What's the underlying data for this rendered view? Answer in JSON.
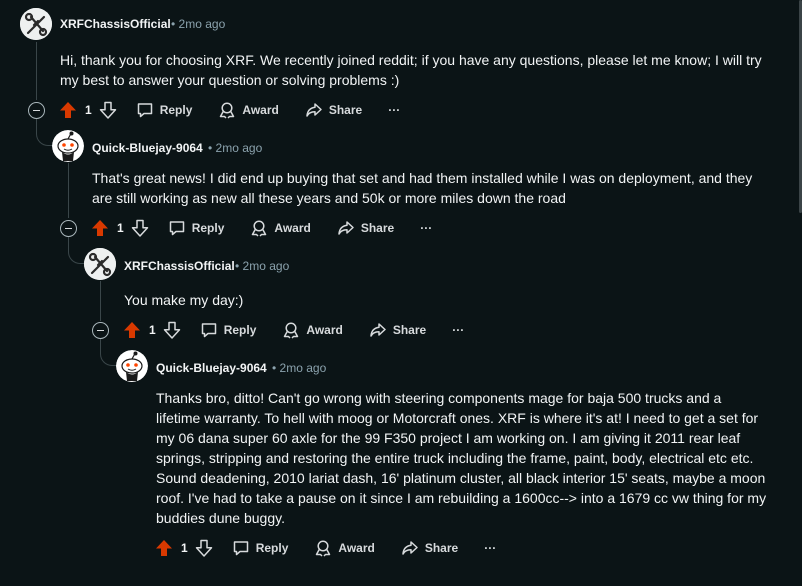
{
  "comments": [
    {
      "author": "XRFChassisOfficial",
      "time": "2mo ago",
      "body": "Hi, thank you for choosing XRF. We recently joined reddit; if you have any questions, please let me know; I will try my best to answer your question or solving problems :)",
      "votes": "1",
      "reply_label": "Reply",
      "award_label": "Award",
      "share_label": "Share",
      "more_label": "···"
    },
    {
      "author": "Quick-Bluejay-9064",
      "time": "2mo ago",
      "body": "That's great news! I did end up buying that set and had them installed while I was on deployment, and they are still working as new all these years and 50k or more miles down the road",
      "votes": "1",
      "reply_label": "Reply",
      "award_label": "Award",
      "share_label": "Share",
      "more_label": "···"
    },
    {
      "author": "XRFChassisOfficial",
      "time": "2mo ago",
      "body": "You make my day:)",
      "votes": "1",
      "reply_label": "Reply",
      "award_label": "Award",
      "share_label": "Share",
      "more_label": "···"
    },
    {
      "author": "Quick-Bluejay-9064",
      "time": "2mo ago",
      "body": "Thanks bro, ditto! Can't go wrong with steering components mage for baja 500 trucks and a lifetime warranty. To hell with moog or Motorcraft ones. XRF is where it's at! I need to get a set for my 06 dana super 60 axle for the 99 F350 project I am working on. I am giving it 2011 rear leaf springs, stripping and restoring the entire truck including the frame, paint, body, electrical etc etc. Sound deadening, 2010 lariat dash, 16' platinum cluster, all black interior 15' seats, maybe a moon roof. I've had to take a pause on it since I am rebuilding a 1600cc--> into a 1679 cc vw thing for my buddies dune buggy.",
      "votes": "1",
      "reply_label": "Reply",
      "award_label": "Award",
      "share_label": "Share",
      "more_label": "···"
    }
  ],
  "icons": {
    "upvote": "upvote-icon",
    "downvote": "downvote-icon",
    "reply": "reply-icon",
    "award": "award-icon",
    "share": "share-icon",
    "collapse": "collapse-icon"
  },
  "colors": {
    "background": "#0b1416",
    "upvote_active": "#d93900",
    "text": "#f2f4f5",
    "meta": "#8ba2ad",
    "thread_line": "#3a4649"
  }
}
